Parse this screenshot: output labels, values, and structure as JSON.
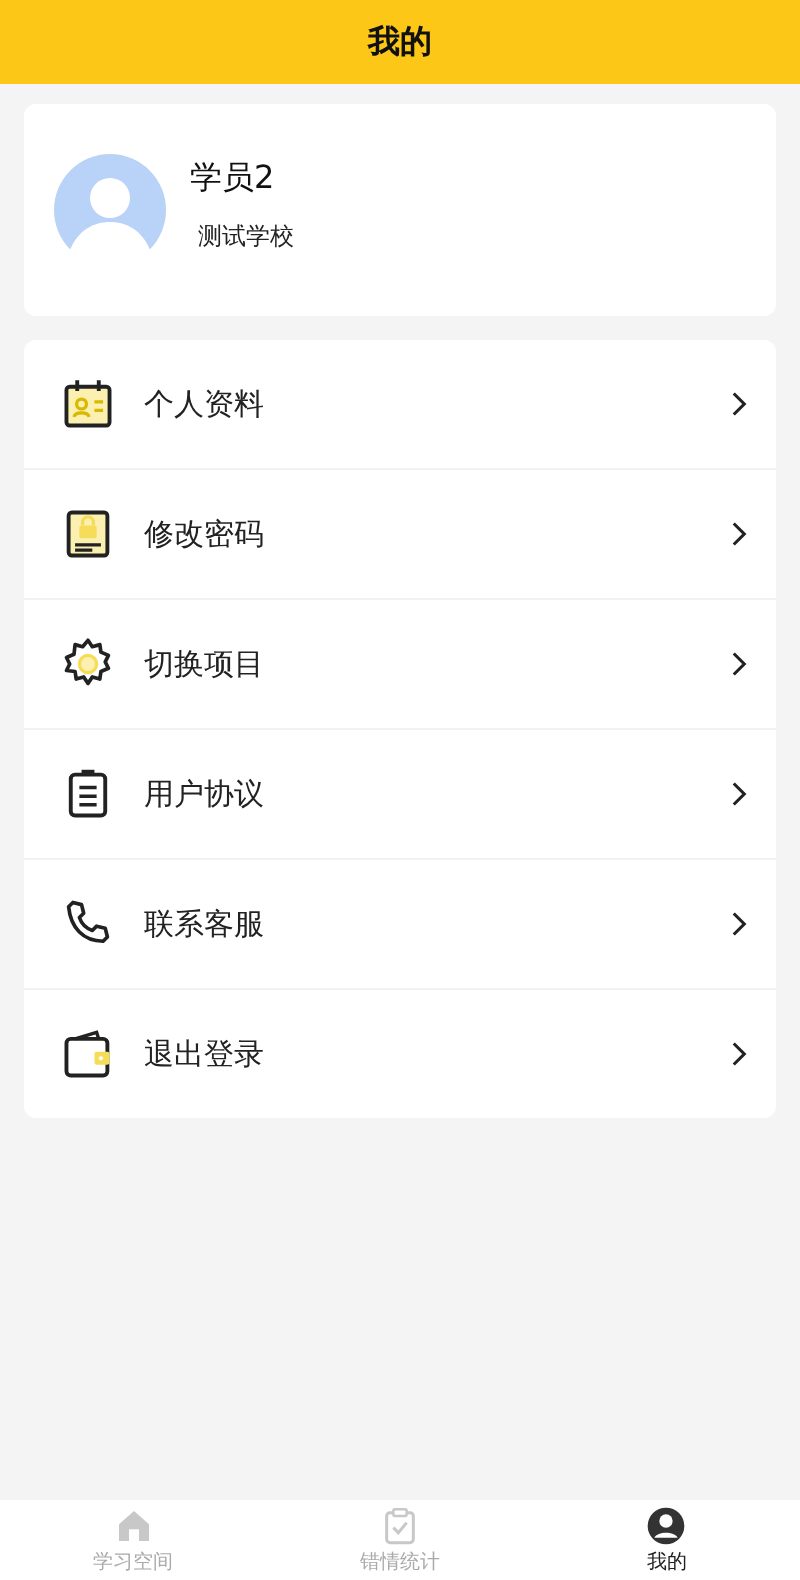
{
  "header": {
    "title": "我的"
  },
  "profile": {
    "name": "学员2",
    "school": "测试学校"
  },
  "menu": [
    {
      "label": "个人资料"
    },
    {
      "label": "修改密码"
    },
    {
      "label": "切换项目"
    },
    {
      "label": "用户协议"
    },
    {
      "label": "联系客服"
    },
    {
      "label": "退出登录"
    }
  ],
  "tabs": [
    {
      "label": "学习空间",
      "selected": false
    },
    {
      "label": "错情统计",
      "selected": false
    },
    {
      "label": "我的",
      "selected": true
    }
  ]
}
